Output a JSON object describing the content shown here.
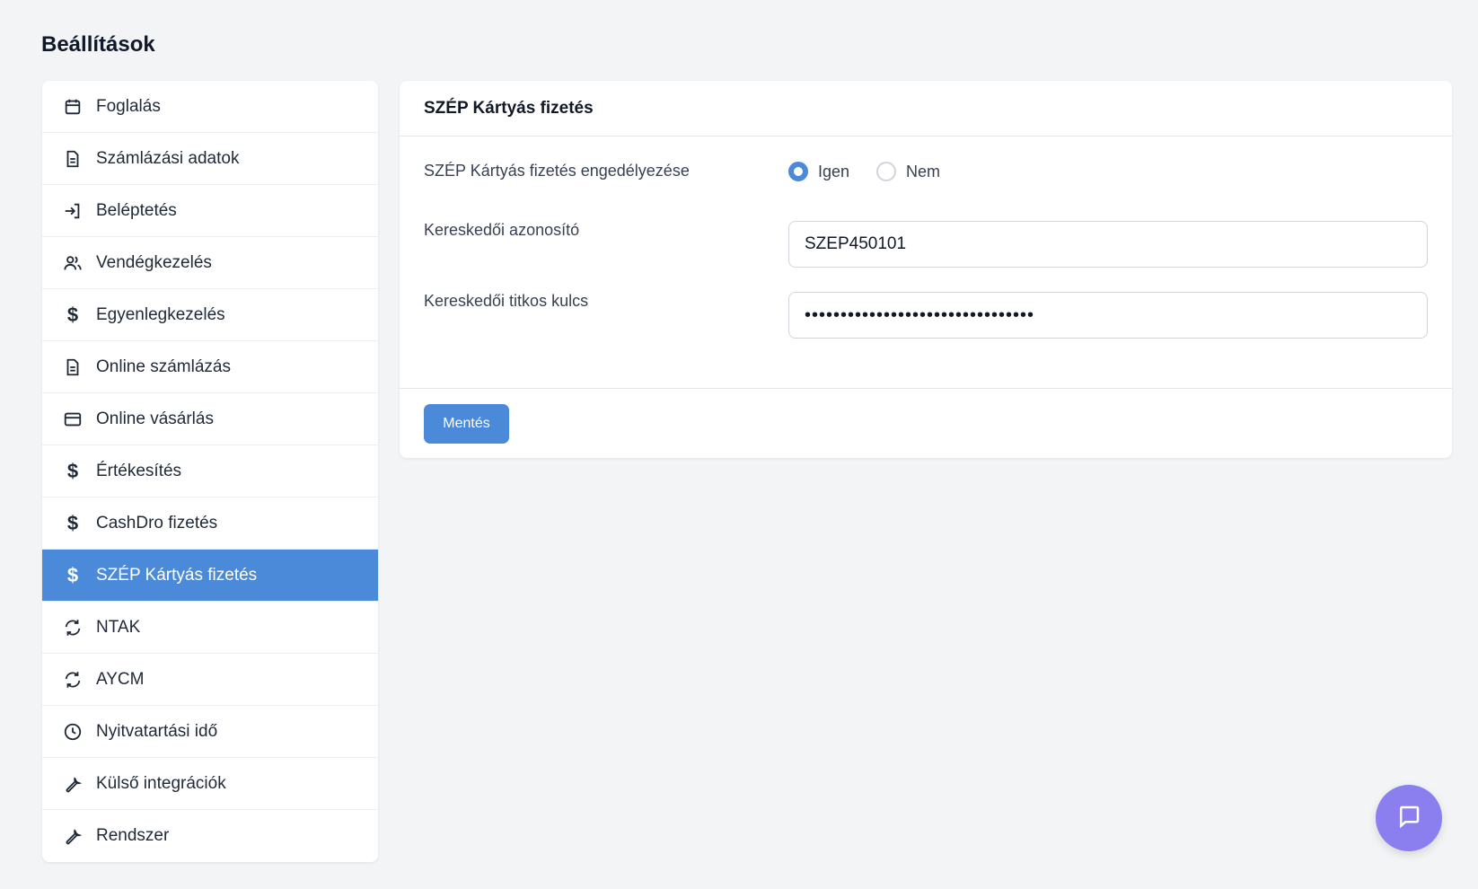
{
  "page": {
    "title": "Beállítások"
  },
  "sidebar": {
    "items": [
      {
        "label": "Foglalás",
        "icon": "calendar-icon"
      },
      {
        "label": "Számlázási adatok",
        "icon": "document-icon"
      },
      {
        "label": "Beléptetés",
        "icon": "login-icon"
      },
      {
        "label": "Vendégkezelés",
        "icon": "users-icon"
      },
      {
        "label": "Egyenlegkezelés",
        "icon": "dollar-icon"
      },
      {
        "label": "Online számlázás",
        "icon": "document-icon"
      },
      {
        "label": "Online vásárlás",
        "icon": "credit-card-icon"
      },
      {
        "label": "Értékesítés",
        "icon": "dollar-icon"
      },
      {
        "label": "CashDro fizetés",
        "icon": "dollar-icon"
      },
      {
        "label": "SZÉP Kártyás fizetés",
        "icon": "dollar-icon",
        "active": true
      },
      {
        "label": "NTAK",
        "icon": "refresh-icon"
      },
      {
        "label": "AYCM",
        "icon": "refresh-icon"
      },
      {
        "label": "Nyitvatartási idő",
        "icon": "clock-icon"
      },
      {
        "label": "Külső integrációk",
        "icon": "wrench-icon"
      },
      {
        "label": "Rendszer",
        "icon": "wrench-icon"
      }
    ]
  },
  "panel": {
    "title": "SZÉP Kártyás fizetés",
    "enable": {
      "label": "SZÉP Kártyás fizetés engedélyezése",
      "options": [
        "Igen",
        "Nem"
      ],
      "selected": "Igen"
    },
    "merchant_id": {
      "label": "Kereskedői azonosító",
      "value": "SZEP450101"
    },
    "merchant_secret": {
      "label": "Kereskedői titkos kulcs",
      "value": "••••••••••••••••••••••••••••••••"
    },
    "save_label": "Mentés"
  },
  "colors": {
    "accent": "#4a8ad8",
    "chat": "#8b7ff0",
    "background": "#f3f4f6"
  },
  "chat": {
    "icon": "chat-icon"
  }
}
